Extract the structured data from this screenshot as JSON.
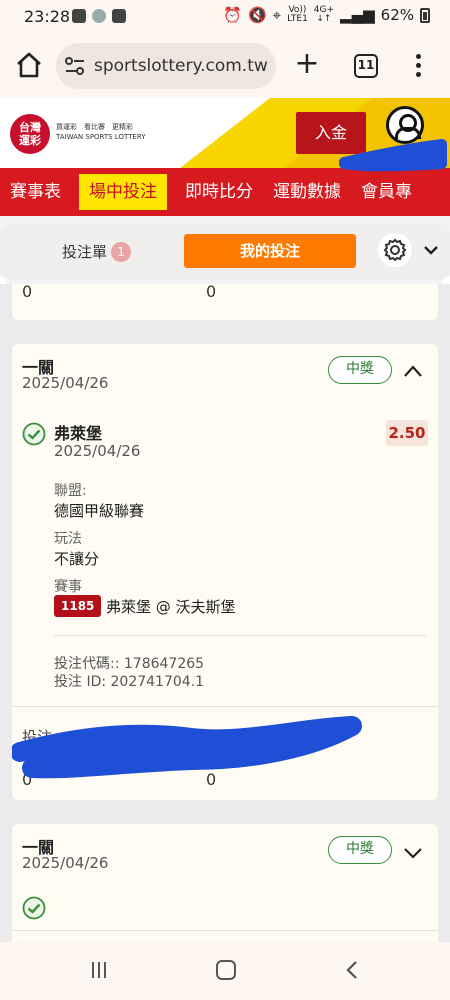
{
  "status_bar": {
    "time": "23:28",
    "signal_top": "Vo))",
    "signal_bottom": "LTE1",
    "network_top": "4G+",
    "network_bottom": "↓↑",
    "battery": "62%"
  },
  "browser": {
    "url": "sportslottery.com.tw",
    "tab_count": "11"
  },
  "site_header": {
    "logo_line1": "台灣",
    "logo_line2": "運彩",
    "logo_sub_line1": "買運彩　看比賽　更精彩",
    "logo_sub_line2": "TAIWAN SPORTS LOTTERY",
    "deposit_label": "入金"
  },
  "nav": {
    "items": [
      "賽事表",
      "場中投注",
      "即時比分",
      "運動數據",
      "會員專"
    ],
    "active_index": 1
  },
  "slip_toolbar": {
    "betslip_label": "投注單",
    "betslip_count": "1",
    "mybets_label": "我的投注"
  },
  "card0": {
    "value_left": "0",
    "value_right": "0"
  },
  "bet1": {
    "type": "一關",
    "date": "2025/04/26",
    "status": "中獎",
    "selection": "弗萊堡",
    "selection_date": "2025/04/26",
    "odds": "2.50",
    "league_label": "聯盟:",
    "league_value": "德國甲級聯賽",
    "market_label": "玩法",
    "market_value": "不讓分",
    "event_label": "賽事",
    "game_number": "1185",
    "event_value": "弗萊堡 @ 沃夫斯堡",
    "bet_code": "投注代碼:: 178647265",
    "bet_id": "投注 ID: 202741704.1",
    "footer_label": "投注",
    "footer_left": "0",
    "footer_right": "0"
  },
  "bet2": {
    "type": "一關",
    "date": "2025/04/26",
    "status": "中獎"
  },
  "icons": [
    "home-icon",
    "tune-icon",
    "plus-icon",
    "tabs-icon",
    "more-vert-icon",
    "user-icon",
    "gear-icon",
    "chevron-down-icon",
    "chevron-up-icon",
    "check-circle-icon"
  ],
  "colors": {
    "brand_red": "#d71920",
    "nav_active_bg": "#ffe600",
    "mybets_orange": "#ff7a00",
    "win_green": "#2d7a2d",
    "odds_red": "#b3261e",
    "scribble_blue": "#1f4fd6"
  }
}
